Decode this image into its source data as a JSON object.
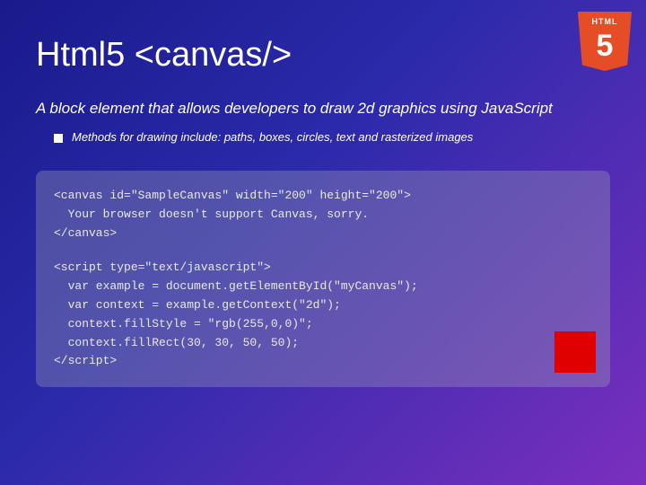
{
  "badge": {
    "label": "HTML",
    "number": "5"
  },
  "title": "Html5 <canvas/>",
  "subtitle": "A block element that allows developers to draw 2d graphics using JavaScript",
  "bullet": {
    "text": "Methods for drawing include: paths, boxes, circles, text and rasterized images"
  },
  "code": {
    "block1": "<canvas id=\"SampleCanvas\" width=\"200\" height=\"200\">\n  Your browser doesn't support Canvas, sorry.\n</canvas>",
    "block2": "<script type=\"text/javascript\">\n  var example = document.getElementById(\"myCanvas\");\n  var context = example.getContext(\"2d\");\n  context.fillStyle = \"rgb(255,0,0)\";\n  context.fillRect(30, 30, 50, 50);\n</script>"
  },
  "red_square_alt": "Red fill rect preview"
}
